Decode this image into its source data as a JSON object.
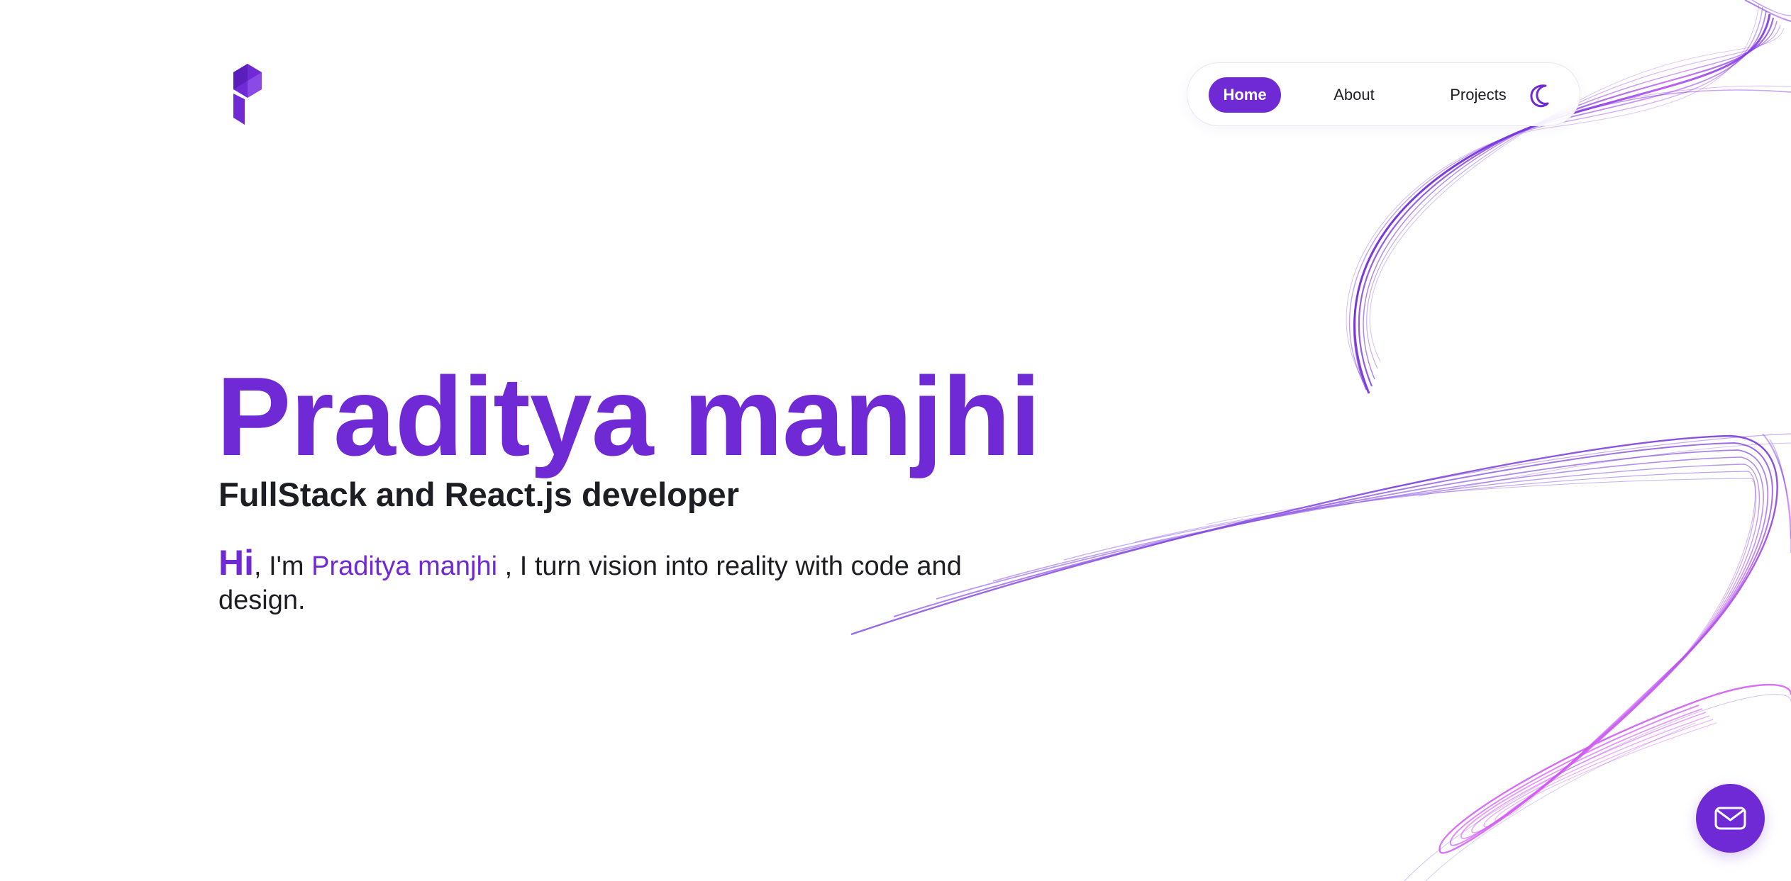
{
  "brand": {
    "logo_icon": "stylized-p-logo-icon",
    "accent_color": "#6f2ad6",
    "text_color": "#1d1d24"
  },
  "nav": {
    "items": [
      {
        "label": "Home",
        "active": true
      },
      {
        "label": "About",
        "active": false
      },
      {
        "label": "Projects",
        "active": false
      }
    ],
    "theme_toggle_icon": "moon-icon"
  },
  "hero": {
    "title": "Praditya manjhi",
    "subtitle": "FullStack and React.js developer",
    "intro": {
      "greeting": "Hi",
      "prefix": ", I'm ",
      "name": "Praditya manjhi",
      "suffix": " , I turn vision into reality with code and design."
    }
  },
  "contact": {
    "icon": "mail-icon"
  }
}
